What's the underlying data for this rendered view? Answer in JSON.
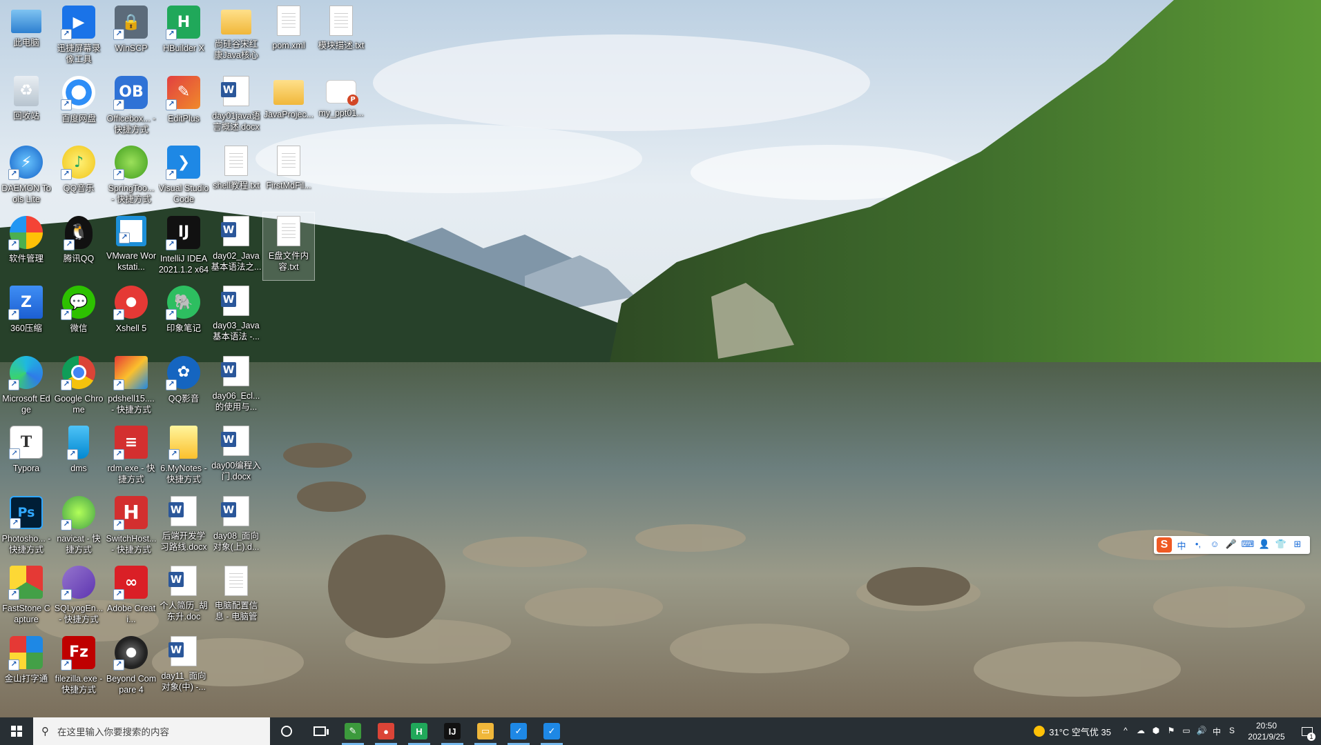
{
  "desktop": {
    "icons": [
      {
        "label": "此电脑",
        "icon": "computer-icon",
        "glyph": ""
      },
      {
        "label": "迅捷屏幕录像工具",
        "icon": "screen-recorder-icon",
        "glyph": "▶"
      },
      {
        "label": "WinSCP",
        "icon": "winscp-icon",
        "glyph": "🔒"
      },
      {
        "label": "HBuilder X",
        "icon": "hbuilder-icon",
        "glyph": "H"
      },
      {
        "label": "尚硅谷宋红康Java核心类...",
        "icon": "folder-icon",
        "glyph": ""
      },
      {
        "label": "pom.xml",
        "icon": "file-icon",
        "glyph": ""
      },
      {
        "label": "模块描述.txt",
        "icon": "text-file-icon",
        "glyph": ""
      },
      {
        "label": "回收站",
        "icon": "recycle-bin-icon",
        "glyph": "♻"
      },
      {
        "label": "百度网盘",
        "icon": "baidu-netdisk-icon",
        "glyph": ""
      },
      {
        "label": "Officebox... - 快捷方式",
        "icon": "officebox-icon",
        "glyph": "OB"
      },
      {
        "label": "EditPlus",
        "icon": "editplus-icon",
        "glyph": "✎"
      },
      {
        "label": "day01java语言概述.docx",
        "icon": "word-doc-icon",
        "glyph": "W"
      },
      {
        "label": "JavaProjec...",
        "icon": "folder-icon",
        "glyph": ""
      },
      {
        "label": "my_ppt01...",
        "icon": "ppt-icon",
        "glyph": "P"
      },
      {
        "label": "DAEMON Tools Lite",
        "icon": "daemon-tools-icon",
        "glyph": "⚡"
      },
      {
        "label": "QQ音乐",
        "icon": "qq-music-icon",
        "glyph": "♪"
      },
      {
        "label": "SpringToo... - 快捷方式",
        "icon": "spring-tools-icon",
        "glyph": ""
      },
      {
        "label": "Visual Studio Code",
        "icon": "vscode-icon",
        "glyph": "❯"
      },
      {
        "label": "shell教程.txt",
        "icon": "text-file-icon",
        "glyph": ""
      },
      {
        "label": "FirstMdFil...",
        "icon": "markdown-file-icon",
        "glyph": ""
      },
      {
        "label": "软件管理",
        "icon": "software-manager-icon",
        "glyph": ""
      },
      {
        "label": "腾讯QQ",
        "icon": "qq-icon",
        "glyph": "🐧"
      },
      {
        "label": "VMware Workstati...",
        "icon": "vmware-icon",
        "glyph": ""
      },
      {
        "label": "IntelliJ IDEA 2021.1.2 x64",
        "icon": "intellij-icon",
        "glyph": "IJ"
      },
      {
        "label": "day02_Java基本语法之...",
        "icon": "word-doc-icon",
        "glyph": "W"
      },
      {
        "label": "E盘文件内容.txt",
        "icon": "text-file-icon",
        "glyph": ""
      },
      {
        "label": "360压缩",
        "icon": "360zip-icon",
        "glyph": "Z"
      },
      {
        "label": "微信",
        "icon": "wechat-icon",
        "glyph": "💬"
      },
      {
        "label": "Xshell 5",
        "icon": "xshell-icon",
        "glyph": ""
      },
      {
        "label": "印象笔记",
        "icon": "evernote-icon",
        "glyph": "🐘"
      },
      {
        "label": "day03_Java基本语法 -...",
        "icon": "word-doc-icon",
        "glyph": "W"
      },
      {
        "label": "Microsoft Edge",
        "icon": "edge-icon",
        "glyph": ""
      },
      {
        "label": "Google Chrome",
        "icon": "chrome-icon",
        "glyph": ""
      },
      {
        "label": "pdshell15.... - 快捷方式",
        "icon": "pdshell-icon",
        "glyph": ""
      },
      {
        "label": "QQ影音",
        "icon": "qq-player-icon",
        "glyph": "✿"
      },
      {
        "label": "day06_Ecl...的使用与...",
        "icon": "word-doc-icon",
        "glyph": "W"
      },
      {
        "label": "Typora",
        "icon": "typora-icon",
        "glyph": "T"
      },
      {
        "label": "dms",
        "icon": "dms-icon",
        "glyph": ""
      },
      {
        "label": "rdm.exe - 快捷方式",
        "icon": "rdm-icon",
        "glyph": "≡"
      },
      {
        "label": "6.MyNotes - 快捷方式",
        "icon": "notes-icon",
        "glyph": ""
      },
      {
        "label": "day00编程入门.docx",
        "icon": "word-doc-icon",
        "glyph": "W"
      },
      {
        "label": "Photosho... - 快捷方式",
        "icon": "photoshop-icon",
        "glyph": "Ps"
      },
      {
        "label": "navicat - 快捷方式",
        "icon": "navicat-icon",
        "glyph": ""
      },
      {
        "label": "SwitchHost... - 快捷方式",
        "icon": "switchhosts-icon",
        "glyph": "H"
      },
      {
        "label": "后端开发学习路线.docx",
        "icon": "word-doc-icon",
        "glyph": "W"
      },
      {
        "label": "day08_面向对象(上).d...",
        "icon": "word-doc-icon",
        "glyph": "W"
      },
      {
        "label": "FastStone Capture",
        "icon": "faststone-icon",
        "glyph": ""
      },
      {
        "label": "SQLyogEn... - 快捷方式",
        "icon": "sqlyog-icon",
        "glyph": ""
      },
      {
        "label": "Adobe Creati...",
        "icon": "adobe-cc-icon",
        "glyph": "∞"
      },
      {
        "label": "个人简历_胡东升.doc",
        "icon": "word-doc-icon",
        "glyph": "W"
      },
      {
        "label": "电脑配置信息 - 电脑管家...",
        "icon": "text-file-icon",
        "glyph": ""
      },
      {
        "label": "金山打字通",
        "icon": "kingsoft-typing-icon",
        "glyph": ""
      },
      {
        "label": "filezilla.exe - 快捷方式",
        "icon": "filezilla-icon",
        "glyph": "Fz"
      },
      {
        "label": "Beyond Compare 4",
        "icon": "beyond-compare-icon",
        "glyph": ""
      },
      {
        "label": "day11_面向对象(中) -...",
        "icon": "word-doc-icon",
        "glyph": "W"
      }
    ]
  },
  "ime": {
    "logo": "S",
    "items": [
      "中",
      "•,",
      "☺",
      "🎤",
      "⌨",
      "👤",
      "👕",
      "⊞"
    ]
  },
  "taskbar": {
    "search_placeholder": "在这里输入你要搜索的内容",
    "apps": [
      {
        "name": "notepad-app",
        "glyph": "✎",
        "color": "#3c9a3c"
      },
      {
        "name": "chrome-app",
        "glyph": "●",
        "color": "#db4437"
      },
      {
        "name": "hbuilder-app",
        "glyph": "H",
        "color": "#20a85a"
      },
      {
        "name": "intellij-app",
        "glyph": "IJ",
        "color": "#111111"
      },
      {
        "name": "file-explorer-app",
        "glyph": "▭",
        "color": "#f0b73a"
      },
      {
        "name": "defender-app-1",
        "glyph": "✓",
        "color": "#1e88e5"
      },
      {
        "name": "defender-app-2",
        "glyph": "✓",
        "color": "#1e88e5"
      }
    ],
    "weather": "31°C 空气优 35",
    "tray_icons": [
      "^",
      "☁",
      "⬢",
      "⚑",
      "▭",
      "🔊",
      "中",
      "S"
    ],
    "time": "20:50",
    "date": "2021/9/25",
    "notification_count": "1"
  }
}
